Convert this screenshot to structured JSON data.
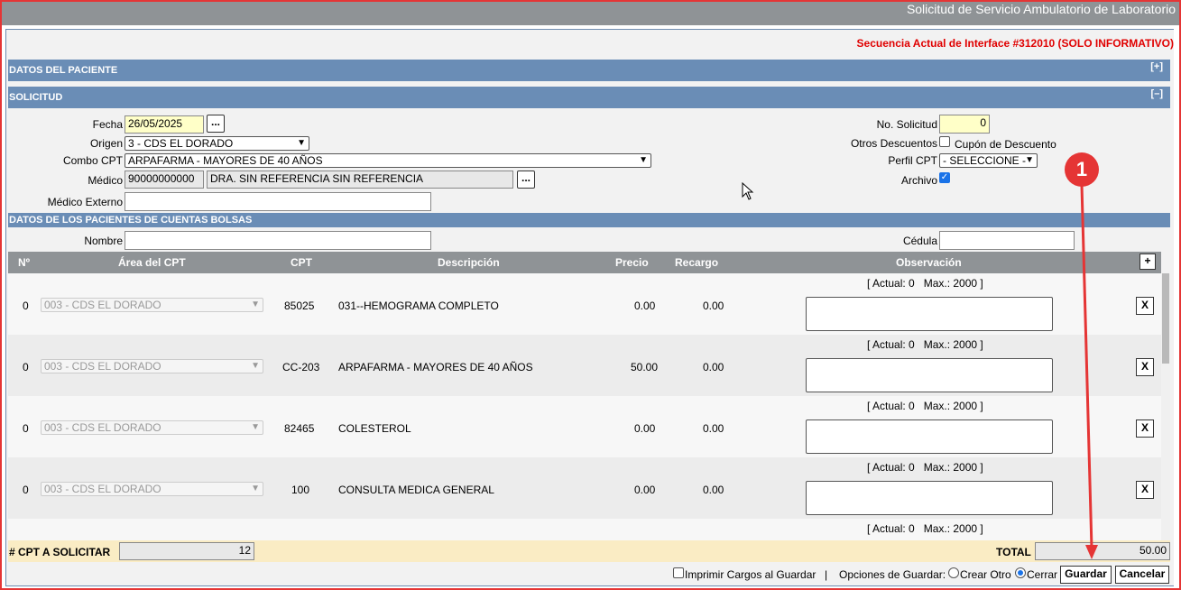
{
  "window": {
    "title": "Solicitud de Servicio Ambulatorio de Laboratorio"
  },
  "sequence_text": "Secuencia Actual de Interface #312010 (SOLO INFORMATIVO)",
  "sections": {
    "patient": {
      "label": "DATOS DEL PACIENTE",
      "toggle": "[+]"
    },
    "request": {
      "label": "SOLICITUD",
      "toggle": "[–]"
    }
  },
  "form": {
    "fecha_label": "Fecha",
    "fecha_value": "26/05/2025",
    "dots": "...",
    "origen_label": "Origen",
    "origen_value": "3 - CDS EL DORADO",
    "combo_label": "Combo CPT",
    "combo_value": "ARPAFARMA - MAYORES DE 40 AÑOS",
    "medico_label": "Médico",
    "medico_code": "90000000000",
    "medico_name": "DRA. SIN REFERENCIA SIN REFERENCIA",
    "medico_externo_label": "Médico Externo",
    "no_solicitud_label": "No. Solicitud",
    "no_solicitud_value": "0",
    "otros_desc_label": "Otros Descuentos",
    "cupon_label": "Cupón de Descuento",
    "perfil_label": "Perfil CPT",
    "perfil_value": "- SELECCIONE -",
    "archivo_label": "Archivo"
  },
  "bolsas": {
    "header": "DATOS DE LOS PACIENTES DE CUENTAS BOLSAS",
    "nombre_label": "Nombre",
    "cedula_label": "Cédula"
  },
  "table": {
    "columns": [
      "Nº",
      "Área del CPT",
      "CPT",
      "Descripción",
      "Precio",
      "Recargo",
      "Observación"
    ],
    "add_button": "+",
    "remove_button": "X",
    "rows": [
      {
        "no": "0",
        "area": "003 - CDS EL DORADO",
        "cpt": "85025",
        "desc": "031--HEMOGRAMA COMPLETO",
        "precio": "0.00",
        "recargo": "0.00",
        "counter": "[ Actual: 0   Max.: 2000 ]"
      },
      {
        "no": "0",
        "area": "003 - CDS EL DORADO",
        "cpt": "CC-203",
        "desc": "ARPAFARMA - MAYORES DE 40 AÑOS",
        "precio": "50.00",
        "recargo": "0.00",
        "counter": "[ Actual: 0   Max.: 2000 ]"
      },
      {
        "no": "0",
        "area": "003 - CDS EL DORADO",
        "cpt": "82465",
        "desc": "COLESTEROL",
        "precio": "0.00",
        "recargo": "0.00",
        "counter": "[ Actual: 0   Max.: 2000 ]"
      },
      {
        "no": "0",
        "area": "003 - CDS EL DORADO",
        "cpt": "100",
        "desc": "CONSULTA MEDICA GENERAL",
        "precio": "0.00",
        "recargo": "0.00",
        "counter": "[ Actual: 0   Max.: 2000 ]"
      }
    ],
    "next_counter": "[ Actual: 0   Max.: 2000 ]"
  },
  "footer": {
    "cpt_label": "# CPT A SOLICITAR",
    "cpt_value": "12",
    "total_label": "TOTAL",
    "total_value": "50.00",
    "imprimir_label": "Imprimir Cargos al Guardar",
    "separator": "|",
    "opciones_label": "Opciones de Guardar:",
    "crear_otro_label": "Crear Otro",
    "cerrar_label": "Cerrar",
    "guardar_button": "Guardar",
    "cancelar_button": "Cancelar"
  },
  "annotation": {
    "marker": "1"
  }
}
